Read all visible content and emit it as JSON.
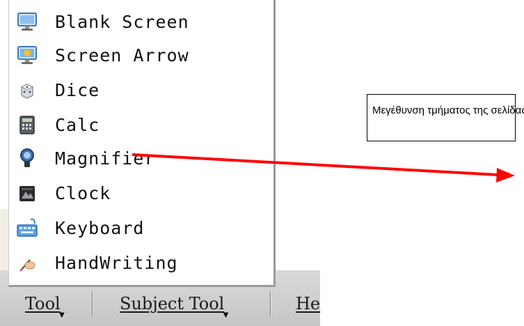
{
  "menu": {
    "items": [
      {
        "label": "Blank Screen",
        "icon": "monitor-icon"
      },
      {
        "label": "Screen Arrow",
        "icon": "screen-arrow-icon"
      },
      {
        "label": "Dice",
        "icon": "dice-icon"
      },
      {
        "label": "Calc",
        "icon": "calculator-icon"
      },
      {
        "label": "Magnifier",
        "icon": "magnifier-icon"
      },
      {
        "label": "Clock",
        "icon": "clock-icon"
      },
      {
        "label": "Keyboard",
        "icon": "keyboard-icon"
      },
      {
        "label": "HandWriting",
        "icon": "handwriting-icon"
      }
    ]
  },
  "menubar": {
    "tool": "Tool",
    "subject_tool": "Subject Tool",
    "help_partial": "He"
  },
  "callout": {
    "text": "Μεγέθυνση τμήματος της σελίδας"
  },
  "colors": {
    "arrow": "#ff0000",
    "menubar": "#cfcfcf"
  }
}
